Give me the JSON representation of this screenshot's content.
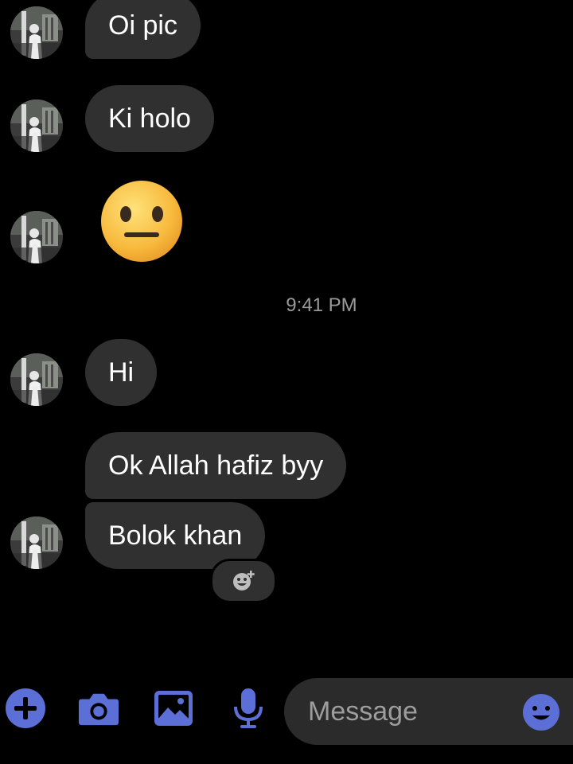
{
  "theme": {
    "background": "#000000",
    "bubble": "#303030",
    "accent": "#5b6fd6",
    "timestamp_color": "#9a9a9a"
  },
  "messages": [
    {
      "type": "text",
      "text": "Oi pic",
      "sender": "contact"
    },
    {
      "type": "text",
      "text": "Ki holo",
      "sender": "contact"
    },
    {
      "type": "emoji",
      "emoji": "neutral-face-emoji",
      "sender": "contact"
    },
    {
      "type": "text",
      "text": "Hi",
      "sender": "contact"
    },
    {
      "type": "text",
      "text": "Ok Allah hafiz byy",
      "sender": "contact"
    },
    {
      "type": "text",
      "text": "Bolok khan",
      "sender": "contact"
    }
  ],
  "timestamp": "9:41 PM",
  "reaction_button": {
    "icon": "add-reaction-icon"
  },
  "composer": {
    "icons": [
      "plus-icon",
      "camera-icon",
      "image-icon",
      "microphone-icon"
    ],
    "placeholder": "Message",
    "emoji_icon": "emoji-icon"
  }
}
